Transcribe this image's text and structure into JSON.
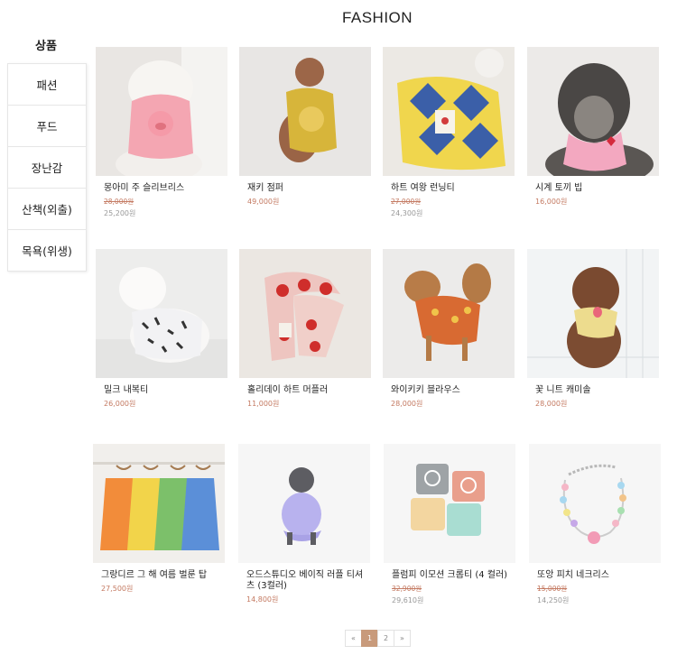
{
  "page": {
    "title": "FASHION"
  },
  "sidebar": {
    "title": "상품",
    "items": [
      {
        "label": "패션"
      },
      {
        "label": "푸드"
      },
      {
        "label": "장난감"
      },
      {
        "label": "산책(외출)"
      },
      {
        "label": "목욕(위생)"
      }
    ]
  },
  "products": [
    {
      "name": "몽아미 주 슬리브리스",
      "original_price": "28,000원",
      "price": "25,200원"
    },
    {
      "name": "재키 점퍼",
      "price": "49,000원"
    },
    {
      "name": "하트 여왕 런닝티",
      "original_price": "27,000원",
      "price": "24,300원"
    },
    {
      "name": "시계 토끼 빕",
      "price": "16,000원"
    },
    {
      "name": "밀크 내복티",
      "price": "26,000원"
    },
    {
      "name": "홀리데이 하트 머플러",
      "price": "11,000원"
    },
    {
      "name": "와이키키 블라우스",
      "price": "28,000원"
    },
    {
      "name": "꽃 니트 캐미솔",
      "price": "28,000원"
    },
    {
      "name": "그랑디르 그 해 여름 벌룬 탑",
      "price": "27,500원"
    },
    {
      "name": "오드스튜디오 베이직 러플 티셔츠 (3컬러)",
      "price": "14,800원"
    },
    {
      "name": "플럼피 이모션 크롭티 (4 컬러)",
      "original_price": "32,900원",
      "price": "29,610원"
    },
    {
      "name": "또앙 피치 네크리스",
      "original_price": "15,000원",
      "price": "14,250원"
    }
  ],
  "pagination": {
    "prev": "«",
    "pages": [
      "1",
      "2"
    ],
    "current": "1",
    "next": "»"
  }
}
